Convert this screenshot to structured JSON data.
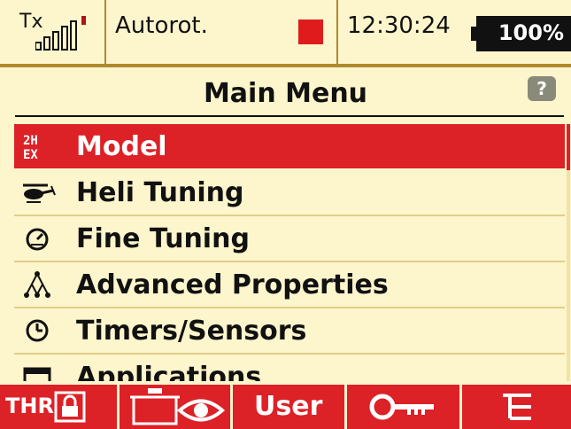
{
  "status_bar": {
    "tx_label": "Tx",
    "signal_icon": "signal-bars-icon",
    "mode": "Autorot.",
    "indicator_color": "#e01b1b",
    "time": "12:30:24",
    "battery": "100%"
  },
  "header": {
    "title": "Main Menu",
    "help_label": "?"
  },
  "menu": {
    "selected_index": 0,
    "items": [
      {
        "label": "Model",
        "icon": "model-2h-icon"
      },
      {
        "label": "Heli Tuning",
        "icon": "helicopter-icon"
      },
      {
        "label": "Fine Tuning",
        "icon": "gauge-icon"
      },
      {
        "label": "Advanced Properties",
        "icon": "hierarchy-icon"
      },
      {
        "label": "Timers/Sensors",
        "icon": "clock-icon"
      },
      {
        "label": "Applications",
        "icon": "applications-icon"
      }
    ]
  },
  "function_bar": {
    "thr_label": "THR",
    "user_label": "User",
    "keys": [
      "throttle-lock-icon",
      "pot-eye-icon",
      "user-button",
      "key-icon",
      "tree-icon"
    ]
  },
  "colors": {
    "accent": "#dc2127",
    "background": "#fdf5cc",
    "divider": "#b08a2c"
  }
}
